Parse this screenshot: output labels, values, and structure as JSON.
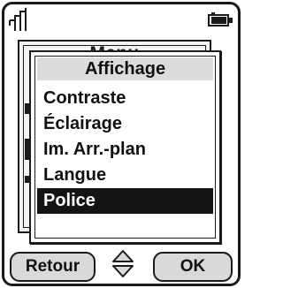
{
  "status_bar": {
    "signal_icon": "signal-strength-icon",
    "battery_icon": "battery-icon"
  },
  "parent_menu": {
    "title": "Menu"
  },
  "dialog": {
    "title": "Affichage",
    "items": [
      {
        "label": "Contraste",
        "selected": false
      },
      {
        "label": "Éclairage",
        "selected": false
      },
      {
        "label": "Im. Arr.-plan",
        "selected": false
      },
      {
        "label": "Langue",
        "selected": false
      },
      {
        "label": "Police",
        "selected": true
      }
    ]
  },
  "softkeys": {
    "left_label": "Retour",
    "right_label": "OK",
    "nav_icon": "up-down-arrows-icon"
  },
  "colors": {
    "selection_bg": "#141414",
    "title_bar_bg": "#dcdcdc",
    "softkey_bg": "#d9d9d9"
  }
}
